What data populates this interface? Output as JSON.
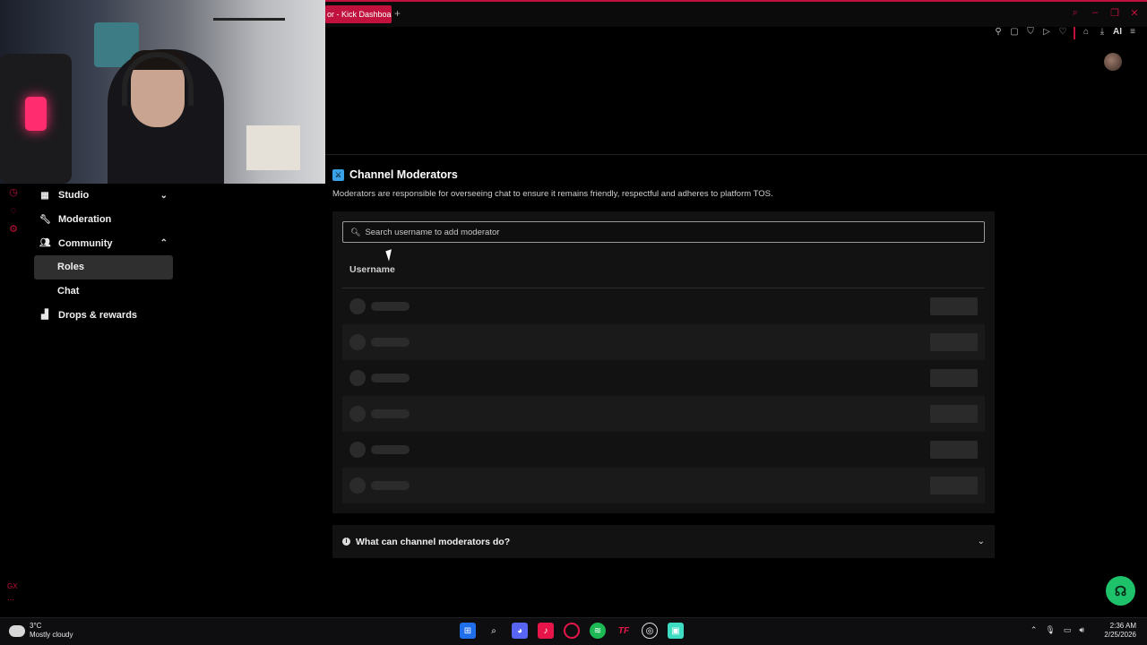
{
  "browser": {
    "tab_title": "or - Kick Dashboard",
    "new_tab_symbol": "+",
    "toolbar_ai_label": "AI"
  },
  "sidebar": {
    "items": [
      {
        "label": "Studio",
        "icon": "studio-icon"
      },
      {
        "label": "Moderation",
        "icon": "wrench-icon"
      },
      {
        "label": "Community",
        "icon": "people-icon"
      },
      {
        "label": "Roles"
      },
      {
        "label": "Chat"
      },
      {
        "label": "Drops & rewards",
        "icon": "gift-icon"
      }
    ]
  },
  "main": {
    "title": "Channel Moderators",
    "description": "Moderators are responsible for overseeing chat to ensure it remains friendly, respectful and adheres to platform TOS.",
    "search_placeholder": "Search username to add moderator",
    "column_header": "Username",
    "faq_label": "What can channel moderators do?"
  },
  "taskbar": {
    "temperature": "3°C",
    "weather": "Mostly cloudy",
    "time": "2:36 AM",
    "date": "2/25/2026"
  },
  "colors": {
    "accent": "#c0123c",
    "help_button": "#1ec26b",
    "title_icon": "#3aa0e8"
  }
}
